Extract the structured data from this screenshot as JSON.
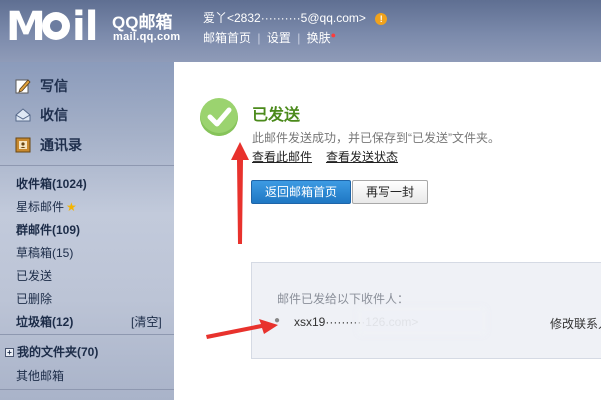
{
  "brand": {
    "logo_text": "MOil",
    "name": "QQ邮箱",
    "url": "mail.qq.com"
  },
  "header": {
    "user_display": "爱丫<2832··········5@qq.com>",
    "warning_symbol": "!",
    "links": [
      "邮箱首页",
      "设置",
      "换肤"
    ]
  },
  "sidebar": {
    "quick_actions": [
      {
        "label": "写信",
        "icon": "pencil-icon"
      },
      {
        "label": "收信",
        "icon": "inbox-tray-icon"
      },
      {
        "label": "通讯录",
        "icon": "contacts-book-icon"
      }
    ],
    "folders": [
      {
        "label": "收件箱(1024)",
        "bold": true
      },
      {
        "label": "星标邮件",
        "bold": false
      },
      {
        "label": "群邮件(109)",
        "bold": true
      },
      {
        "label": "草稿箱(15)",
        "bold": false
      },
      {
        "label": "已发送",
        "bold": false
      },
      {
        "label": "已删除",
        "bold": false
      },
      {
        "label": "垃圾箱(12)",
        "bold": true
      }
    ],
    "clear_label": "[清空]",
    "my_folders": "我的文件夹(70)",
    "other_mailbox": "其他邮箱"
  },
  "main": {
    "title": "已发送",
    "description": "此邮件发送成功，并已保存到“已发送”文件夹。",
    "view_mail_link": "查看此邮件",
    "view_status_link": "查看发送状态",
    "back_button": "返回邮箱首页",
    "rewrite_button": "再写一封",
    "recipients_heading": "邮件已发给以下收件人：",
    "recipient_email": "xsx19··········126.com>",
    "edit_contact": "修改联系人"
  },
  "colors": {
    "header_bg": "#6f7fa2",
    "success_green": "#4b8a1b",
    "primary_button": "#2a86d3",
    "annotation_arrow": "#e8322d"
  }
}
